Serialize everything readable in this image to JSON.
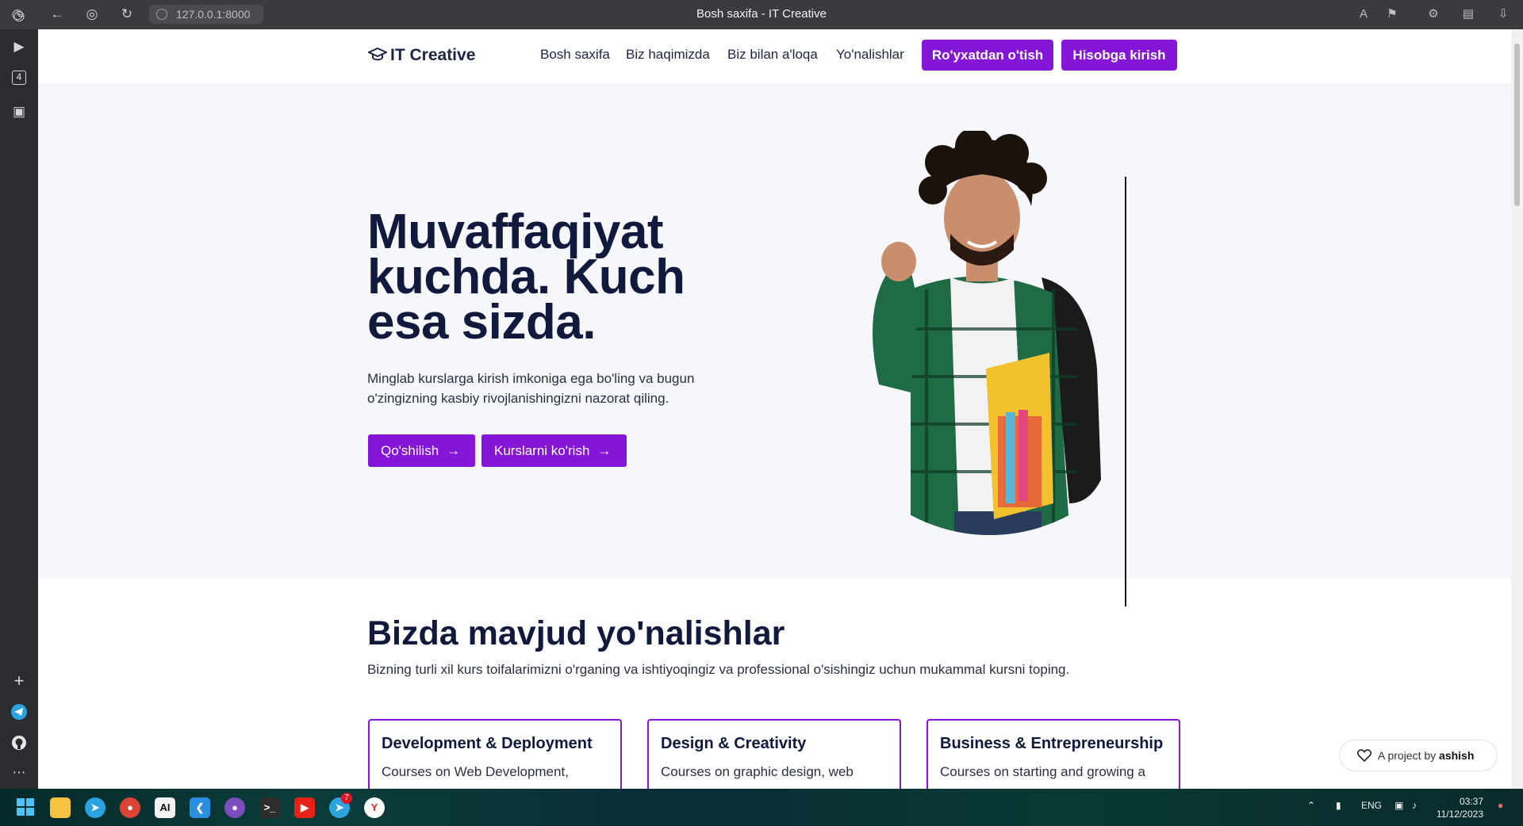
{
  "browser": {
    "url": "127.0.0.1:8000",
    "tab_title": "Bosh saxifa - IT Creative",
    "sidebar_badge": "4"
  },
  "site": {
    "logo_text": "IT Creative",
    "nav": [
      "Bosh saxifa",
      "Biz haqimizda",
      "Biz bilan a'loqa",
      "Yo'nalishlar"
    ],
    "register_label": "Ro'yxatdan o'tish",
    "login_label": "Hisobga kirish",
    "accent_color": "#8516d8"
  },
  "hero": {
    "title_lines": [
      "Muvaffaqiyat",
      "kuchda. Kuch",
      "esa sizda."
    ],
    "description": "Minglab kurslarga kirish imkoniga ega bo'ling va bugun o'zingizning kasbiy rivojlanishingizni nazorat qiling.",
    "join_label": "Qo'shilish",
    "courses_label": "Kurslarni ko'rish",
    "image": "student-with-backpack-photo"
  },
  "directions": {
    "title": "Bizda mavjud yo'nalishlar",
    "description": "Bizning turli xil kurs toifalarimizni o'rganing va ishtiyoqingiz va professional o'sishingiz uchun mukammal kursni toping.",
    "cards": [
      {
        "title": "Development & Deployment",
        "text": "Courses on Web Development,"
      },
      {
        "title": "Design & Creativity",
        "text": "Courses on graphic design, web"
      },
      {
        "title": "Business & Entrepreneurship",
        "text": "Courses on starting and growing a"
      }
    ]
  },
  "credit": {
    "prefix": "A project by",
    "author": "ashish"
  },
  "taskbar": {
    "language": "ENG",
    "time": "03:37",
    "date": "11/12/2023",
    "telegram_badge": "7"
  }
}
